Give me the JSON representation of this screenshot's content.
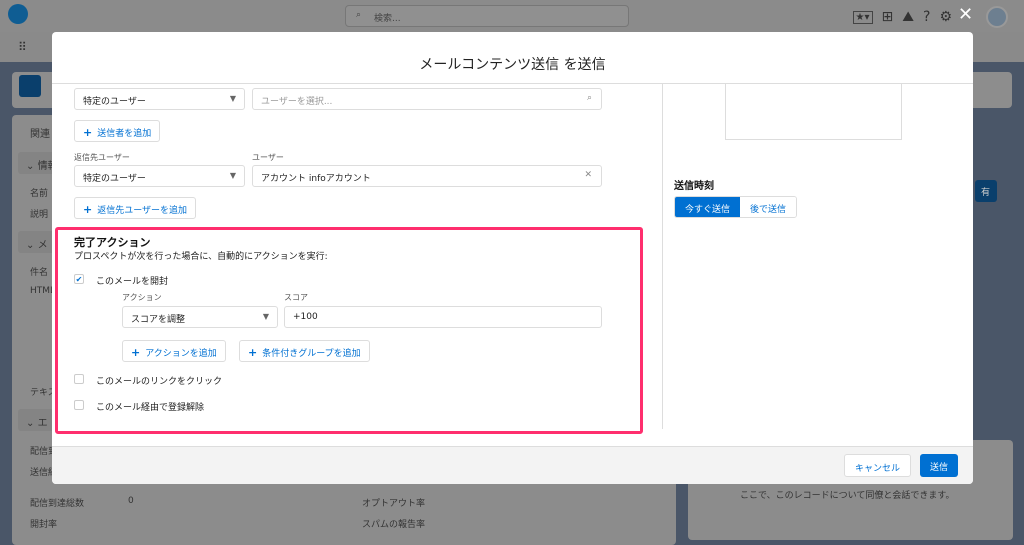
{
  "global": {
    "search_placeholder": "検索...",
    "close_label": "✕"
  },
  "background": {
    "related_tab": "関連",
    "sections": [
      "情報",
      "メ",
      "エ"
    ],
    "rows_left": [
      "名前",
      "説明",
      "件名",
      "HTML",
      "テキス",
      "配信到",
      "送信経"
    ],
    "stats": [
      {
        "label": "配信到達総数",
        "value": "0"
      },
      {
        "label": "開封率",
        "value": ""
      }
    ],
    "stats_right": [
      "オプトアウト率",
      "スパムの報告率"
    ],
    "share_label": "有",
    "chatter_text": "ここで、このレコードについて同僚と会話できます。"
  },
  "modal": {
    "title": "メールコンテンツ送信 を送信",
    "sender": {
      "type_value": "特定のユーザー",
      "user_placeholder": "ユーザーを選択...",
      "add_label": "送信者を追加"
    },
    "reply_to": {
      "type_label": "返信先ユーザー",
      "user_label": "ユーザー",
      "type_value": "特定のユーザー",
      "user_value": "アカウント infoアカウント",
      "add_label": "返信先ユーザーを追加"
    },
    "completion": {
      "title": "完了アクション",
      "description": "プロスペクトが次を行った場合に、自動的にアクションを実行:",
      "options": [
        {
          "label": "このメールを開封",
          "checked": true
        },
        {
          "label": "このメールのリンクをクリック",
          "checked": false
        },
        {
          "label": "このメール経由で登録解除",
          "checked": false
        }
      ],
      "action_label": "アクション",
      "score_label": "スコア",
      "action_value": "スコアを調整",
      "score_value": "+100",
      "add_action_label": "アクションを追加",
      "add_group_label": "条件付きグループを追加"
    },
    "send_time": {
      "title": "送信時刻",
      "now_label": "今すぐ送信",
      "later_label": "後で送信",
      "selected": "今すぐ送信"
    },
    "footer": {
      "cancel_label": "キャンセル",
      "send_label": "送信"
    }
  },
  "colors": {
    "accent": "#0070d2",
    "highlight": "#ff2f6e"
  }
}
